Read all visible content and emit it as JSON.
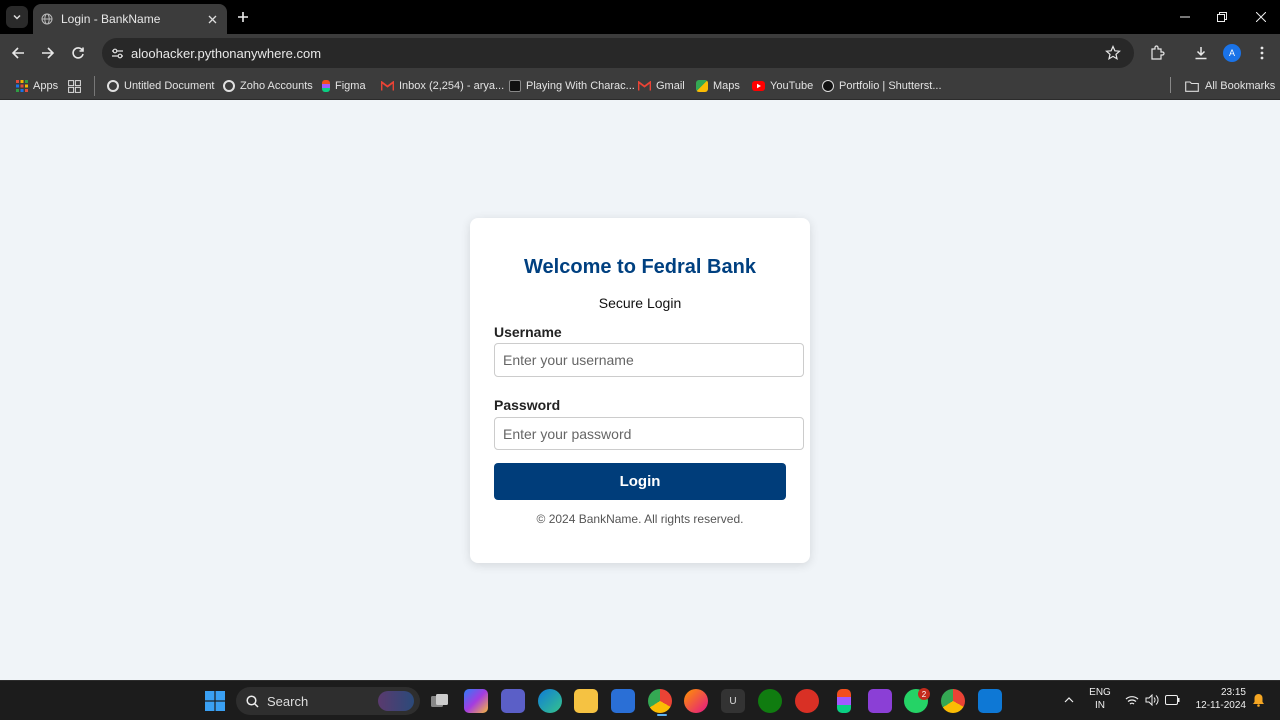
{
  "browser": {
    "tab_title": "Login - BankName",
    "url": "aloohacker.pythonanywhere.com",
    "profile_initial": "A",
    "bookmarks": [
      "Apps",
      "Untitled Document",
      "Zoho Accounts",
      "Figma",
      "Inbox (2,254) - arya...",
      "Playing With Charac...",
      "Gmail",
      "Maps",
      "YouTube",
      "Portfolio | Shutterst..."
    ],
    "all_bookmarks": "All Bookmarks"
  },
  "login": {
    "title": "Welcome to Fedral Bank",
    "subtitle": "Secure Login",
    "username_label": "Username",
    "username_placeholder": "Enter your username",
    "password_label": "Password",
    "password_placeholder": "Enter your password",
    "button_label": "Login",
    "footer": "© 2024 BankName. All rights reserved."
  },
  "taskbar": {
    "search_label": "Search",
    "lang_line1": "ENG",
    "lang_line2": "IN",
    "time": "23:15",
    "date": "12-11-2024",
    "whatsapp_badge": "2"
  },
  "colors": {
    "title": "#004080",
    "button": "#003d7a",
    "page_bg": "#f0f4f8"
  }
}
